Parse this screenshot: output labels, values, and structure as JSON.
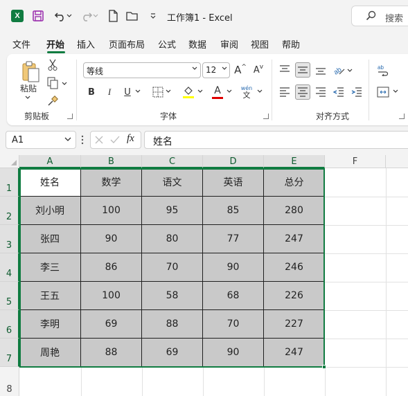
{
  "window": {
    "title": "工作簿1 - Excel",
    "search_label": "搜索",
    "app_logo": "X"
  },
  "menu": {
    "tabs": [
      "文件",
      "开始",
      "插入",
      "页面布局",
      "公式",
      "数据",
      "审阅",
      "视图",
      "帮助"
    ],
    "active": "开始"
  },
  "ribbon": {
    "clipboard": {
      "label": "剪贴板",
      "paste_label": "粘贴"
    },
    "font": {
      "label": "字体",
      "family": "等线",
      "size": "12",
      "grow": "A",
      "shrink": "A",
      "bold": "B",
      "italic": "I",
      "underline": "U",
      "font_color_letter": "A",
      "phonetic_top": "wén",
      "phonetic_bottom": "文"
    },
    "alignment": {
      "label": "对齐方式"
    }
  },
  "formula_bar": {
    "name_box": "A1",
    "fx_label": "fx",
    "content": "姓名"
  },
  "sheet": {
    "columns": [
      "A",
      "B",
      "C",
      "D",
      "E",
      "F"
    ],
    "rows": [
      "1",
      "2",
      "3",
      "4",
      "5",
      "6",
      "7",
      "8"
    ],
    "data": [
      [
        "姓名",
        "数学",
        "语文",
        "英语",
        "总分"
      ],
      [
        "刘小明",
        "100",
        "95",
        "85",
        "280"
      ],
      [
        "张四",
        "90",
        "80",
        "77",
        "247"
      ],
      [
        "李三",
        "86",
        "70",
        "90",
        "246"
      ],
      [
        "王五",
        "100",
        "58",
        "68",
        "226"
      ],
      [
        "李明",
        "69",
        "88",
        "70",
        "227"
      ],
      [
        "周艳",
        "88",
        "69",
        "90",
        "247"
      ]
    ],
    "selected_range": "A1:E7",
    "active_cell": "A1",
    "colors": {
      "accent": "#107c41",
      "selection_fill": "#c9c9c9"
    }
  }
}
